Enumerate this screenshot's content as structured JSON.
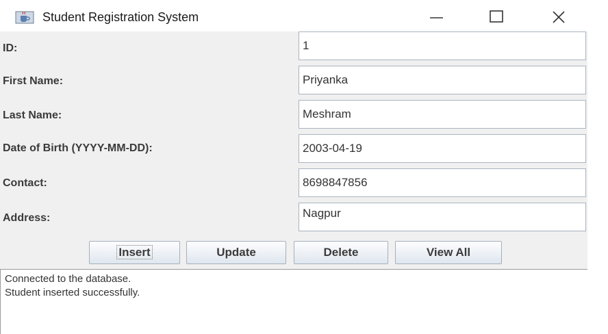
{
  "window": {
    "title": "Student Registration System",
    "icons": {
      "app": "java-cup-icon",
      "minimize": "minimize-icon",
      "maximize": "maximize-icon",
      "close": "close-icon"
    }
  },
  "form": {
    "id": {
      "label": "ID:",
      "value": "1"
    },
    "first_name": {
      "label": "First Name:",
      "value": "Priyanka"
    },
    "last_name": {
      "label": "Last Name:",
      "value": "Meshram"
    },
    "dob": {
      "label": "Date of Birth (YYYY-MM-DD):",
      "value": "2003-04-19"
    },
    "contact": {
      "label": "Contact:",
      "value": "8698847856"
    },
    "address": {
      "label": "Address:",
      "value": "Nagpur"
    }
  },
  "buttons": {
    "insert": "Insert",
    "update": "Update",
    "delete": "Delete",
    "view_all": "View All"
  },
  "log": {
    "lines": [
      "Connected to the database.",
      "Student inserted successfully."
    ]
  },
  "colors": {
    "window_bg": "#f0f0f0",
    "titlebar_bg": "#ffffff",
    "field_border": "#a9b3bf",
    "button_gradient_top": "#fdfdfe",
    "button_gradient_bottom": "#dfe6ee"
  }
}
